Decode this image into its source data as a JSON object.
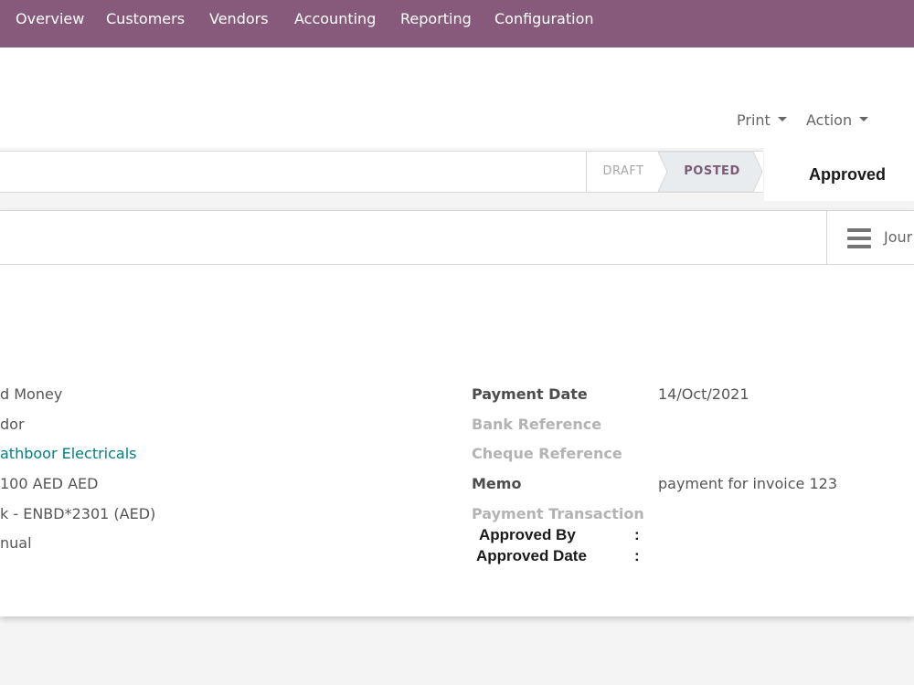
{
  "nav": {
    "items": [
      "Overview",
      "Customers",
      "Vendors",
      "Accounting",
      "Reporting",
      "Configuration"
    ]
  },
  "control_panel": {
    "print_label": "Print",
    "action_label": "Action"
  },
  "statusbar": {
    "stages": [
      "DRAFT",
      "POSTED"
    ],
    "active_stage": "POSTED",
    "approved_label": "Approved"
  },
  "button_box": {
    "journal_label": "Jour"
  },
  "form": {
    "left_values": [
      "d Money",
      "dor",
      "athboor Electricals",
      "100 AED  AED",
      "k - ENBD*2301 (AED)",
      "nual"
    ],
    "payment_date_label": "Payment Date",
    "payment_date_value": "14/Oct/2021",
    "bank_reference_label": "Bank Reference",
    "cheque_reference_label": "Cheque Reference",
    "memo_label": "Memo",
    "memo_value": "payment for invoice 123",
    "payment_transaction_label": "Payment Transaction",
    "approved_by_label": "Approved By",
    "approved_date_label": "Approved Date",
    "colon": ":"
  },
  "colors": {
    "navbar": "#875a7b",
    "link": "#017e84",
    "posted_stage_bg": "#e9ecef"
  }
}
